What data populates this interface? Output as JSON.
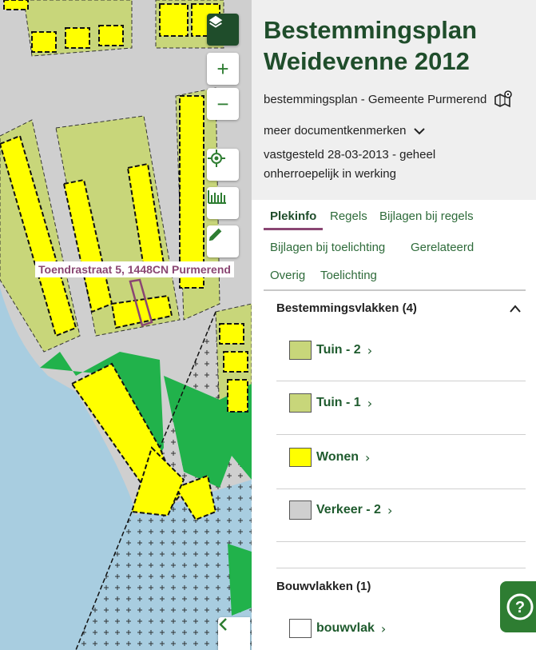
{
  "map": {
    "address_label": "Toendrastraat 5, 1448CN Purmerend",
    "colors": {
      "wonen": "#ffff00",
      "tuin": "#c8d67a",
      "verkeer": "#cfcfcf",
      "water": "#a8cde0",
      "groen": "#21b24b",
      "accent": "#1f4d2b"
    },
    "controls": [
      "layers-icon",
      "zoom-in-icon",
      "zoom-out-icon",
      "locate-icon",
      "measure-icon",
      "edit-icon",
      "chevron-left-icon"
    ]
  },
  "panel": {
    "title": "Bestemmingsplan Weidevenne 2012",
    "subtitle": "bestemmingsplan - Gemeente Purmerend",
    "meer_label": "meer documentkenmerken",
    "status": "vastgesteld 28-03-2013 - geheel onherroepelijk in werking",
    "tabs": [
      "Plekinfo",
      "Regels",
      "Bijlagen bij regels",
      "Bijlagen bij toelichting",
      "Gerelateerd",
      "Overig",
      "Toelichting"
    ],
    "bestemmingsvlakken": {
      "heading": "Bestemmingsvlakken (4)",
      "items": [
        {
          "label": "Tuin - 2",
          "color": "#c8d67a"
        },
        {
          "label": "Tuin - 1",
          "color": "#c8d67a"
        },
        {
          "label": "Wonen",
          "color": "#ffff00"
        },
        {
          "label": "Verkeer - 2",
          "color": "#cfcfcf"
        }
      ]
    },
    "bouwvlakken": {
      "heading": "Bouwvlakken (1)",
      "items": [
        {
          "label": "bouwvlak",
          "color": "#ffffff"
        }
      ]
    },
    "help_label": "?"
  }
}
